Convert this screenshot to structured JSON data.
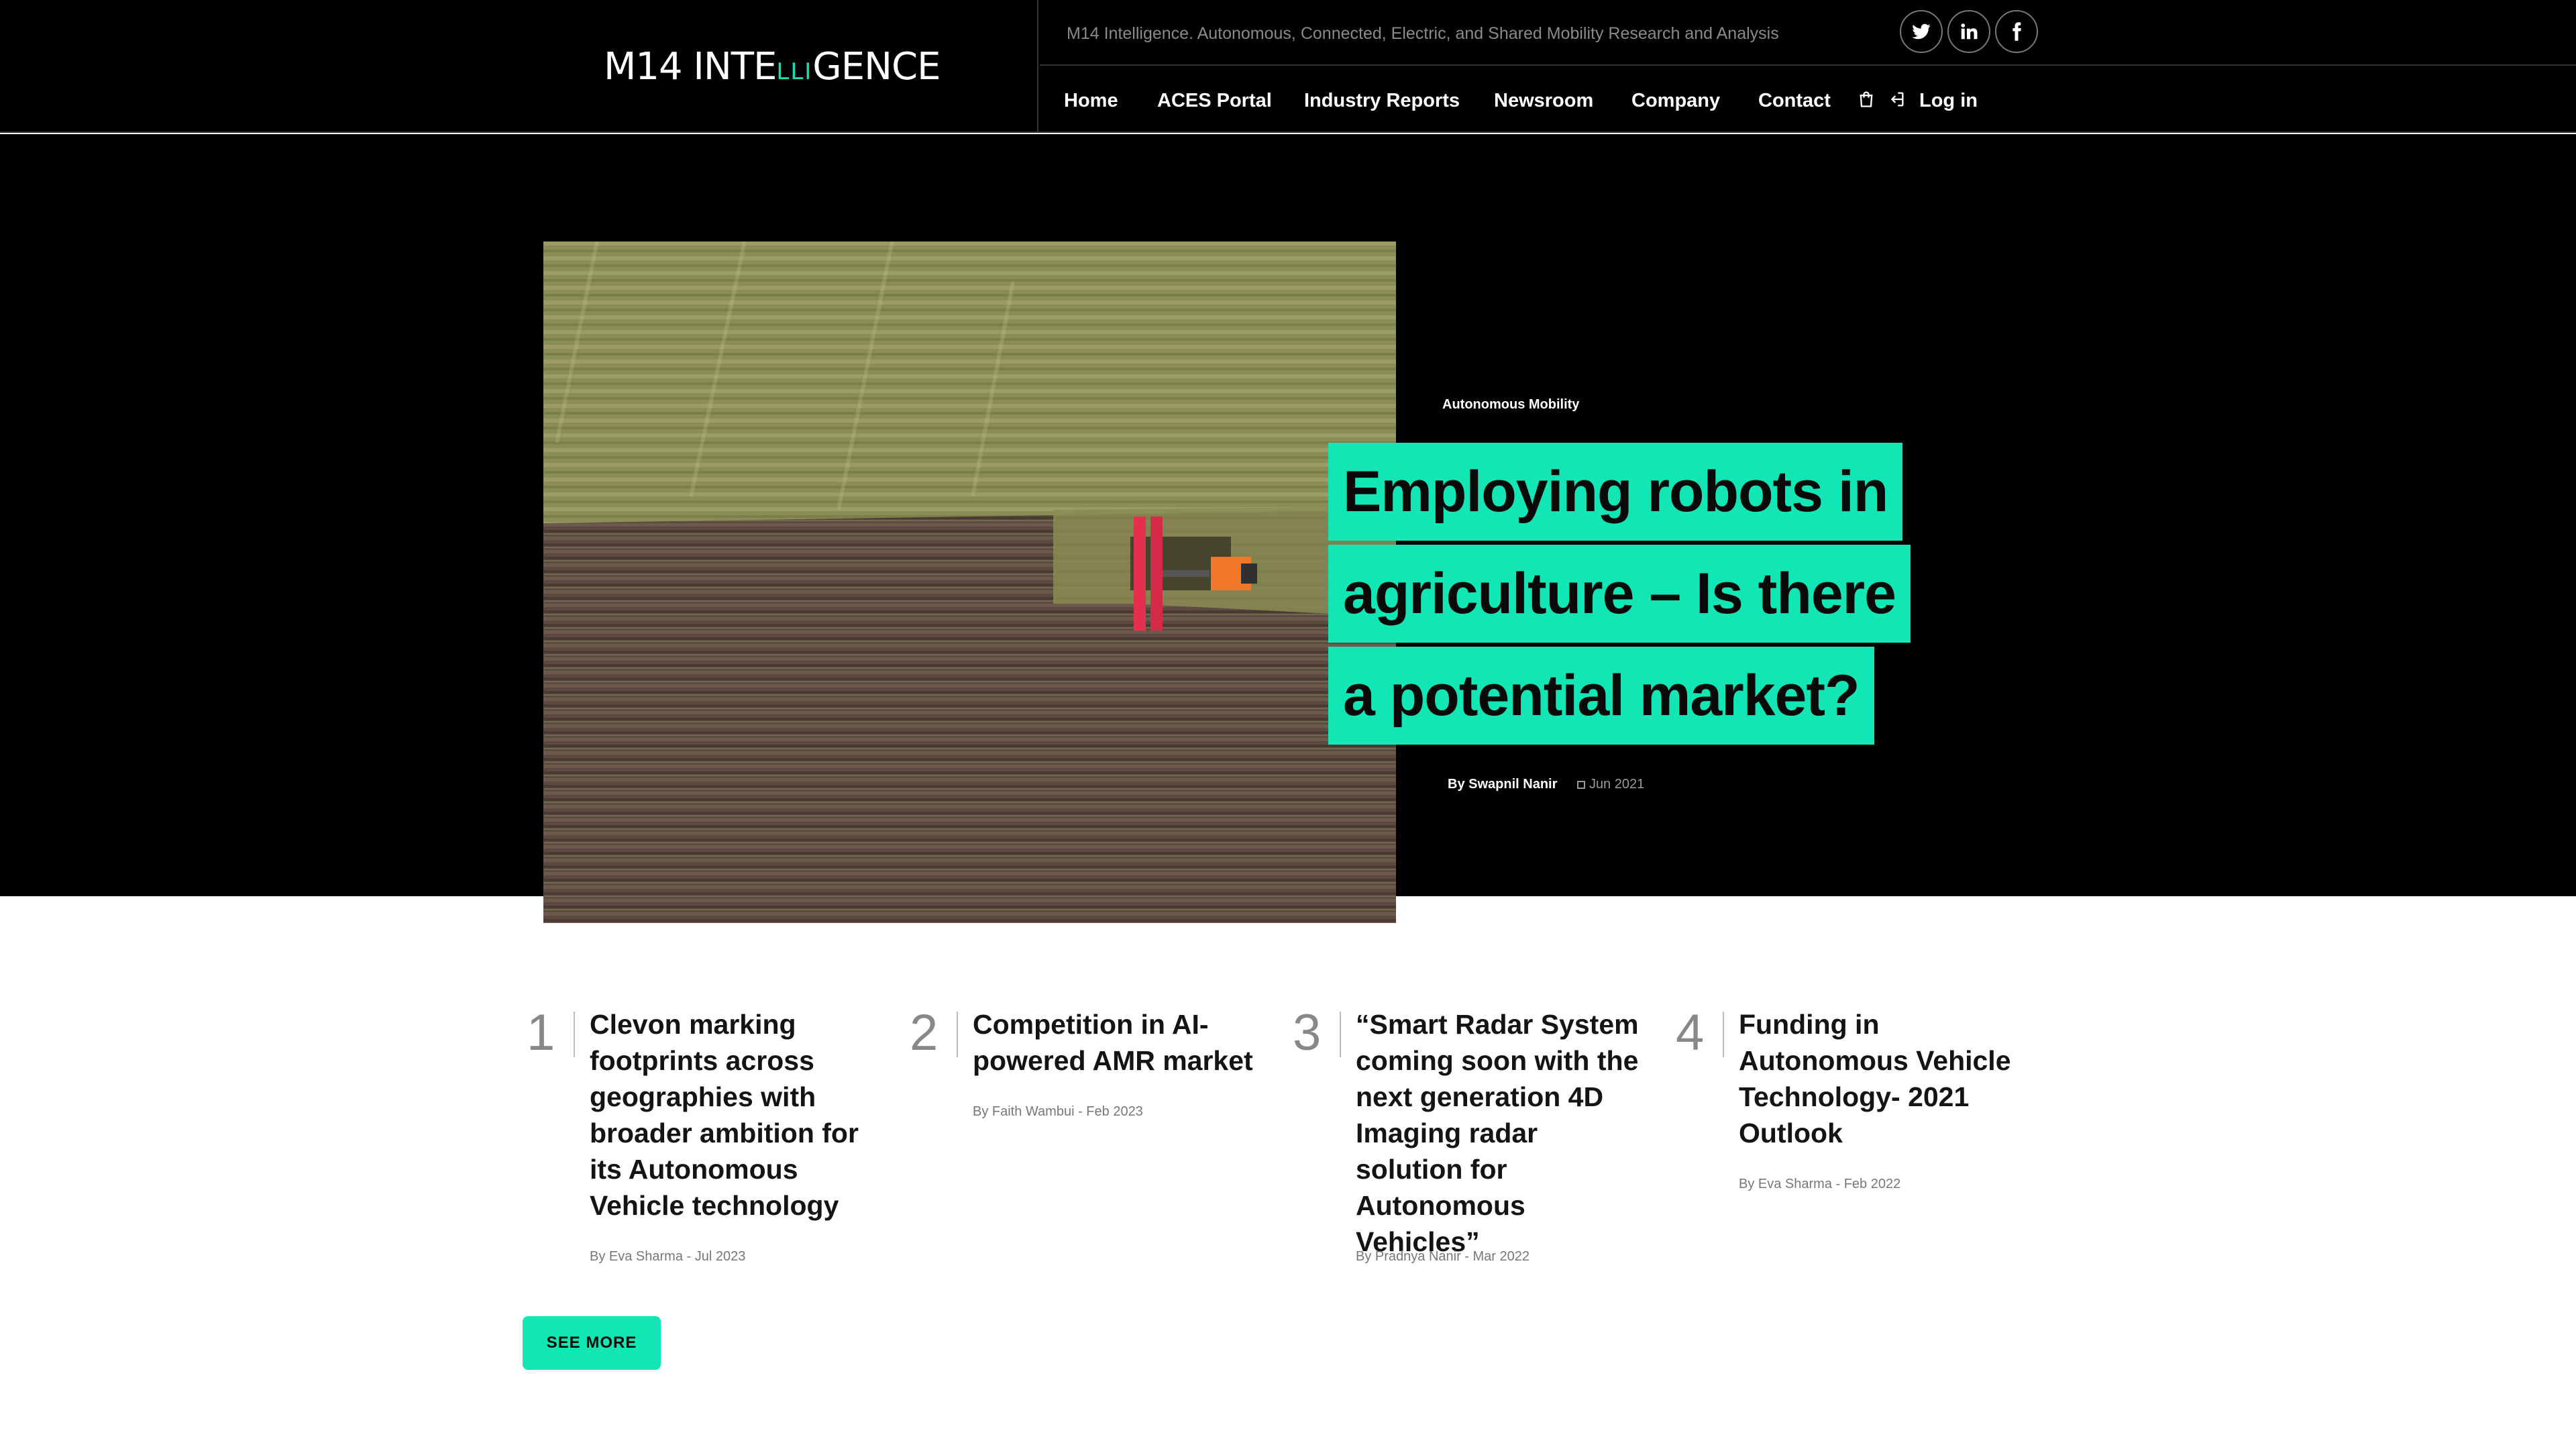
{
  "brand": {
    "logo_left": "M14 INTE",
    "logo_accent": "LLI",
    "logo_right": "GENCE",
    "tagline": "M14 Intelligence. Autonomous, Connected, Electric, and Shared Mobility Research and Analysis",
    "accent_color": "#12e6b4"
  },
  "social": [
    {
      "icon": "twitter-icon"
    },
    {
      "icon": "linkedin-icon"
    },
    {
      "icon": "facebook-icon"
    }
  ],
  "nav": {
    "items": [
      "Home",
      "ACES Portal",
      "Industry Reports",
      "Newsroom",
      "Company",
      "Contact"
    ],
    "cart_icon": "cart-icon",
    "login_icon": "login-icon",
    "login_label": "Log in"
  },
  "hero": {
    "category": "Autonomous Mobility",
    "headline_lines": [
      "Employing robots in",
      "agriculture – Is there",
      "a potential market?"
    ],
    "author": "By Swapnil Nanir",
    "date": "Jun 2021",
    "image_alt": "tractor-field-aerial"
  },
  "articles": [
    {
      "num": "1",
      "title": "Clevon marking footprints across geographies with broader ambition for its Autonomous Vehicle technology",
      "byline": "By Eva Sharma - Jul 2023"
    },
    {
      "num": "2",
      "title": "Competition in AI-powered AMR market",
      "byline": "By Faith Wambui - Feb 2023"
    },
    {
      "num": "3",
      "title": "“Smart Radar System coming soon with the next generation 4D Imaging radar solution for Autonomous Vehicles”",
      "byline": "By Pradnya Nanir - Mar 2022"
    },
    {
      "num": "4",
      "title": "Funding in Autonomous Vehicle Technology- 2021 Outlook",
      "byline": "By Eva Sharma - Feb 2022"
    }
  ],
  "see_more_label": "SEE MORE"
}
